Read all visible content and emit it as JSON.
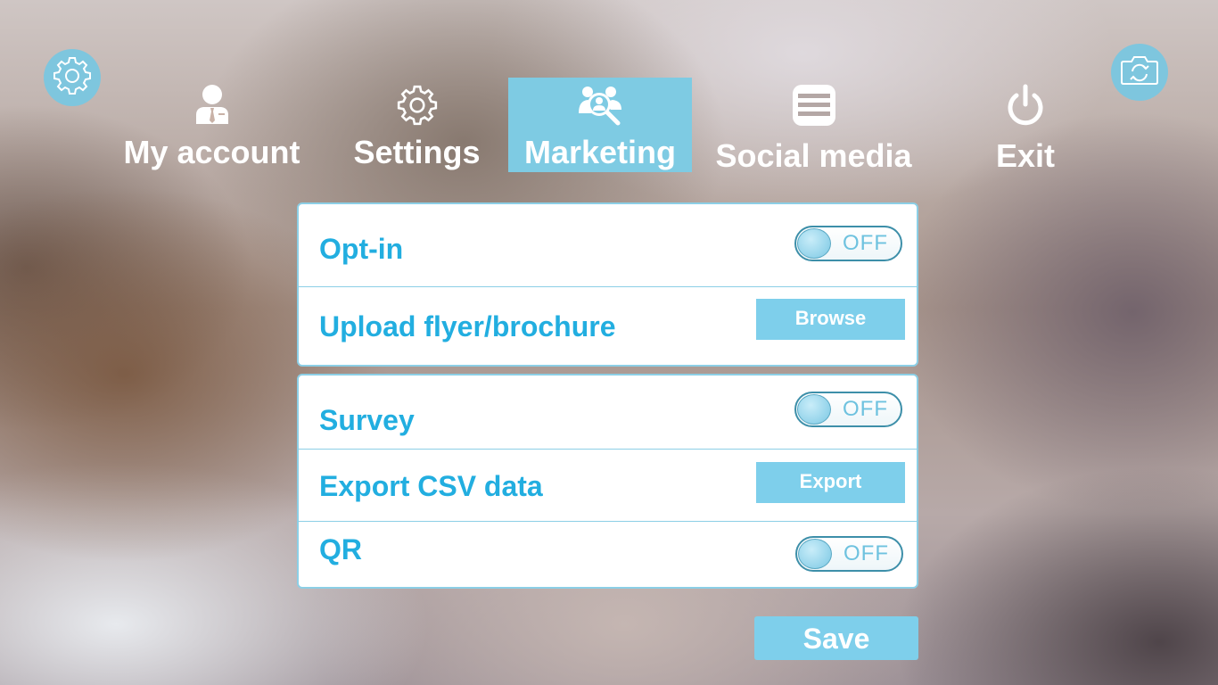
{
  "nav": {
    "items": [
      {
        "label": "My account",
        "icon": "user-icon"
      },
      {
        "label": "Settings",
        "icon": "gear-icon"
      },
      {
        "label": "Marketing",
        "icon": "people-search-icon",
        "active": true
      },
      {
        "label": "Social media",
        "icon": "list-icon"
      },
      {
        "label": "Exit",
        "icon": "power-icon"
      }
    ]
  },
  "corner": {
    "left_icon": "gear-icon",
    "right_icon": "camera-rotate-icon"
  },
  "panel1": {
    "rows": [
      {
        "label": "Opt-in",
        "control": "toggle",
        "state": "OFF"
      },
      {
        "label": "Upload flyer/brochure",
        "control": "button",
        "button_label": "Browse"
      }
    ]
  },
  "panel2": {
    "rows": [
      {
        "label": "Survey",
        "control": "toggle",
        "state": "OFF"
      },
      {
        "label": "Export CSV data",
        "control": "button",
        "button_label": "Export"
      },
      {
        "label": "QR",
        "control": "toggle",
        "state": "OFF"
      }
    ]
  },
  "save_label": "Save",
  "colors": {
    "accent": "#7ecfeb",
    "label_text": "#22aee0",
    "panel_border": "#8ccfe6",
    "toggle_text": "#6ec2df"
  }
}
